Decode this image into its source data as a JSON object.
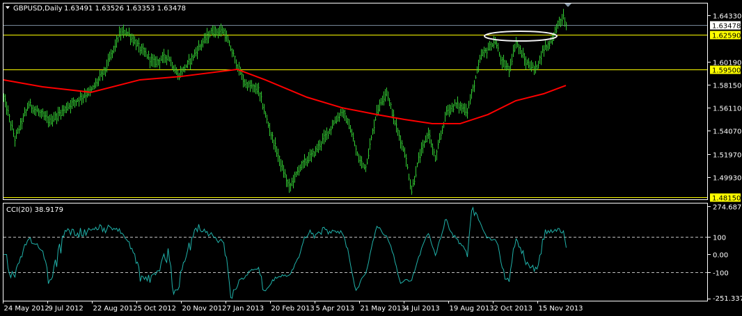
{
  "header": {
    "symbol_timeframe": "GBPUSD,Daily",
    "ohlc": "1.63491 1.63526 1.63353 1.63478"
  },
  "colors": {
    "background": "#000000",
    "bars": "#33cc33",
    "moving_average": "#ff0000",
    "support_resistance": "#ffff00",
    "bid_line": "#778899",
    "cci_line": "#20b2aa",
    "grid_frame": "#ffffff"
  },
  "chart_data": [
    {
      "type": "line",
      "title": "GBPUSD,Daily",
      "subtitle": "1.63491 1.63526 1.63353 1.63478",
      "series_style": "hlc-bars",
      "ylim": [
        1.4794,
        1.6538
      ],
      "y_ticks": [
        "1.64330",
        "1.60190",
        "1.58150",
        "1.56110",
        "1.54070",
        "1.51970",
        "1.49930"
      ],
      "x_ticks": [
        "24 May 2012",
        "9 Jul 2012",
        "22 Aug 2012",
        "5 Oct 2012",
        "20 Nov 2012",
        "7 Jan 2013",
        "20 Feb 2013",
        "5 Apr 2013",
        "21 May 2013",
        "4 Jul 2013",
        "19 Aug 2013",
        "2 Oct 2013",
        "15 Nov 2013"
      ],
      "x_tick_bar_spacing": 32,
      "total_bars": 405,
      "price_closes_approx": [
        [
          0,
          1.5703
        ],
        [
          8,
          1.5332
        ],
        [
          18,
          1.5641
        ],
        [
          33,
          1.5487
        ],
        [
          48,
          1.5641
        ],
        [
          63,
          1.5765
        ],
        [
          73,
          1.5951
        ],
        [
          83,
          1.626
        ],
        [
          88,
          1.6291
        ],
        [
          98,
          1.6136
        ],
        [
          108,
          1.6012
        ],
        [
          118,
          1.6074
        ],
        [
          125,
          1.5889
        ],
        [
          133,
          1.6012
        ],
        [
          143,
          1.6198
        ],
        [
          150,
          1.6291
        ],
        [
          158,
          1.6291
        ],
        [
          165,
          1.6074
        ],
        [
          173,
          1.5827
        ],
        [
          183,
          1.5765
        ],
        [
          190,
          1.5456
        ],
        [
          198,
          1.5147
        ],
        [
          205,
          1.4899
        ],
        [
          213,
          1.5085
        ],
        [
          223,
          1.5208
        ],
        [
          233,
          1.5394
        ],
        [
          243,
          1.558
        ],
        [
          248,
          1.5456
        ],
        [
          255,
          1.5147
        ],
        [
          260,
          1.5085
        ],
        [
          268,
          1.558
        ],
        [
          275,
          1.5765
        ],
        [
          280,
          1.5518
        ],
        [
          288,
          1.5208
        ],
        [
          293,
          1.4868
        ],
        [
          298,
          1.5147
        ],
        [
          305,
          1.5394
        ],
        [
          310,
          1.5147
        ],
        [
          318,
          1.558
        ],
        [
          325,
          1.5641
        ],
        [
          333,
          1.558
        ],
        [
          338,
          1.5827
        ],
        [
          343,
          1.6074
        ],
        [
          348,
          1.6136
        ],
        [
          353,
          1.6198
        ],
        [
          358,
          1.6012
        ],
        [
          363,
          1.5951
        ],
        [
          368,
          1.6198
        ],
        [
          375,
          1.6012
        ],
        [
          382,
          1.5951
        ],
        [
          388,
          1.6136
        ],
        [
          393,
          1.6198
        ],
        [
          398,
          1.6353
        ],
        [
          402,
          1.6414
        ],
        [
          404,
          1.63478
        ]
      ],
      "moving_average": {
        "name": "MA (red)",
        "points": [
          [
            0,
            1.5858
          ],
          [
            28,
            1.5796
          ],
          [
            63,
            1.5747
          ],
          [
            98,
            1.5858
          ],
          [
            128,
            1.5889
          ],
          [
            168,
            1.5951
          ],
          [
            188,
            1.5858
          ],
          [
            218,
            1.5703
          ],
          [
            243,
            1.561
          ],
          [
            268,
            1.5549
          ],
          [
            288,
            1.5505
          ],
          [
            308,
            1.5468
          ],
          [
            328,
            1.5468
          ],
          [
            348,
            1.5549
          ],
          [
            368,
            1.5672
          ],
          [
            388,
            1.5734
          ],
          [
            404,
            1.5808
          ]
        ]
      },
      "horizontal_lines": [
        {
          "label": "1.63478",
          "value": 1.63478,
          "kind": "bid"
        },
        {
          "label": "1.62590",
          "value": 1.6259,
          "kind": "level"
        },
        {
          "label": "1.59500",
          "value": 1.595,
          "kind": "level"
        },
        {
          "label": "1.48150",
          "value": 1.4815,
          "kind": "level"
        }
      ],
      "annotation": "ellipse around 1.62590 resistance (Aug–Nov 2013)"
    },
    {
      "type": "line",
      "title": "CCI(20) 38.9179",
      "indicator": "CCI",
      "period": 20,
      "last_value": 38.9179,
      "ylim": [
        -263.2,
        294.5
      ],
      "y_ticks": [
        "274.6873",
        "100",
        "0.00",
        "-100",
        "-251.3371"
      ],
      "levels": [
        100,
        -100
      ]
    }
  ]
}
